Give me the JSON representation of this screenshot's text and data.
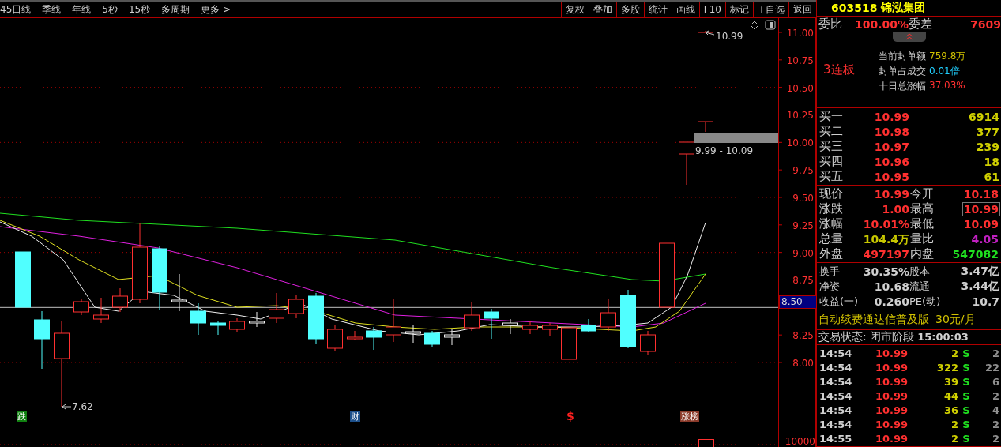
{
  "top_bar": {
    "periods": [
      "45日线",
      "季线",
      "年线",
      "5秒",
      "15秒",
      "多周期",
      "更多 >"
    ],
    "tools": [
      "复权",
      "叠加",
      "多股",
      "统计",
      "画线",
      "F10",
      "标记",
      "+自选",
      "返回"
    ]
  },
  "chart": {
    "price_axis": [
      "11.00",
      "10.75",
      "10.50",
      "10.25",
      "10.00",
      "9.75",
      "9.50",
      "9.25",
      "9.00",
      "8.75",
      "8.25",
      "8.00"
    ],
    "current_price": "8.50",
    "high_label": "10.99",
    "low_label": "7.62",
    "range_label": "9.99 - 10.09",
    "markers": [
      {
        "text": "跌",
        "kind": "badge",
        "color": "#108010"
      },
      {
        "text": "财",
        "kind": "badge",
        "color": "#1c4f8a"
      },
      {
        "text": "$",
        "kind": "glyph",
        "color": "#ff2020"
      },
      {
        "text": "涨榜",
        "kind": "badge",
        "color": "#8a3a2a"
      }
    ],
    "volume_axis": "10000"
  },
  "quote": {
    "code": "603518",
    "name": "锦泓集团",
    "order_ratio": {
      "label": "委比",
      "value": "100.00%"
    },
    "order_diff": {
      "label": "委差",
      "value": "7609"
    },
    "streak": "3连板",
    "seal_stats": [
      {
        "label": "当前封单额",
        "value": "759.8万",
        "color": "#d0c000"
      },
      {
        "label": "封单占成交",
        "value": "0.01倍",
        "color": "#20d0ff"
      },
      {
        "label": "十日总涨幅",
        "value": "37.03%",
        "color": "#ff3030"
      }
    ],
    "bids": [
      {
        "label": "买一",
        "price": "10.99",
        "volume": "6914"
      },
      {
        "label": "买二",
        "price": "10.98",
        "volume": "377"
      },
      {
        "label": "买三",
        "price": "10.97",
        "volume": "239"
      },
      {
        "label": "买四",
        "price": "10.96",
        "volume": "18"
      },
      {
        "label": "买五",
        "price": "10.95",
        "volume": "61"
      }
    ],
    "quotes": [
      {
        "label": "现价",
        "value": "10.99",
        "color": "#ff3030",
        "boxed": false
      },
      {
        "label": "今开",
        "value": "10.18",
        "color": "#ff3030",
        "boxed": false
      },
      {
        "label": "涨跌",
        "value": "1.00",
        "color": "#ff3030",
        "boxed": false
      },
      {
        "label": "最高",
        "value": "10.99",
        "color": "#ff3030",
        "boxed": true
      },
      {
        "label": "涨幅",
        "value": "10.01%",
        "color": "#ff3030",
        "boxed": false
      },
      {
        "label": "最低",
        "value": "10.09",
        "color": "#ff3030",
        "boxed": false
      },
      {
        "label": "总量",
        "value": "104.4万",
        "color": "#c8c800",
        "boxed": false
      },
      {
        "label": "量比",
        "value": "4.05",
        "color": "#c020c0",
        "boxed": false
      },
      {
        "label": "外盘",
        "value": "497197",
        "color": "#ff3030",
        "boxed": false
      },
      {
        "label": "内盘",
        "value": "547082",
        "color": "#20e020",
        "boxed": false
      }
    ],
    "fundamentals": [
      {
        "label": "换手",
        "value": "30.35%"
      },
      {
        "label": "股本",
        "value": "3.47亿"
      },
      {
        "label": "净资",
        "value": "10.68"
      },
      {
        "label": "流通",
        "value": "3.44亿"
      },
      {
        "label": "收益(一)",
        "value": "0.260"
      },
      {
        "label": "PE(动)",
        "value": "10.7"
      }
    ],
    "promo": {
      "text": "自动续费通达信普及版",
      "price": "30元/月"
    },
    "status": {
      "label": "交易状态: 闭市阶段",
      "time": "15:00:03"
    },
    "ticks": [
      {
        "time": "14:54",
        "price": "10.99",
        "volume": "2",
        "side": "S",
        "column_5": "2"
      },
      {
        "time": "14:54",
        "price": "10.99",
        "volume": "322",
        "side": "S",
        "column_5": "22"
      },
      {
        "time": "14:54",
        "price": "10.99",
        "volume": "39",
        "side": "S",
        "column_5": "6"
      },
      {
        "time": "14:54",
        "price": "10.99",
        "volume": "44",
        "side": "S",
        "column_5": "2"
      },
      {
        "time": "14:54",
        "price": "10.99",
        "volume": "36",
        "side": "S",
        "column_5": "4"
      },
      {
        "time": "14:54",
        "price": "10.99",
        "volume": "2",
        "side": "S",
        "column_5": "2"
      },
      {
        "time": "14:55",
        "price": "10.99",
        "volume": "2",
        "side": "S",
        "column_5": "2"
      }
    ]
  }
}
